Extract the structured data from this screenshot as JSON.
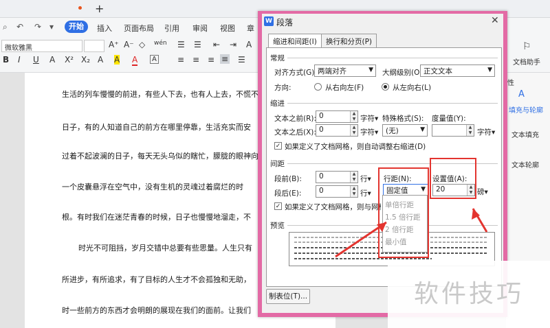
{
  "tabbar": {
    "new_tab_label": "+"
  },
  "menu": {
    "start": "开始",
    "items": [
      "插入",
      "页面布局",
      "引用",
      "审阅",
      "视图",
      "章"
    ]
  },
  "ribbon": {
    "font_name": "微软雅黑",
    "row1_glyphs": [
      "A⁺",
      "A⁻",
      "◇",
      "wén",
      "☰",
      "☰",
      "⇤",
      "⇥",
      "A"
    ],
    "row2_glyphs": [
      "B",
      "I",
      "U",
      "A",
      "X²",
      "X₂",
      "A",
      "A",
      "A",
      "A",
      "≡",
      "≡",
      "≡",
      "≡",
      "☰"
    ]
  },
  "side": {
    "doc_helper": "文档助手",
    "attr": "性",
    "fill_outline": "填充与轮廓",
    "text_fill": "文本填充",
    "text_outline": "文本轮廓"
  },
  "doc_lines": [
    "生活的列车慢慢的前进，有些人下去，也有人上去，不慌不",
    "日子，有的人知道自己的前方在哪里停靠，生活充实而安",
    "过着不起波澜的日子，每天无头乌似的瞎忙，朦胧的眼神向",
    "一个皮囊悬浮在空气中，没有生机的灵魂过着腐烂的时",
    "根。有时我们在迷茫青春的时候，日子也慢慢地溜走，不",
    "时光不可阻挡，岁月交错中总要有些思量。人生只有",
    "所进步，有所追求，有了目标的人生才不会孤独和无助，",
    "时一些前方的东西才会明朗的展现在我们的面前。让我们"
  ],
  "dialog": {
    "title": "段落",
    "logo": "W",
    "close": "✕",
    "tabs": [
      "缩进和间距(I)",
      "换行和分页(P)"
    ],
    "general": {
      "section": "常规",
      "align_label": "对齐方式(G):",
      "align_value": "两端对齐",
      "outline_label": "大纲级别(O):",
      "outline_value": "正文文本",
      "direction_label": "方向:",
      "rtl": "从右向左(F)",
      "ltr": "从左向右(L)"
    },
    "indent": {
      "section": "缩进",
      "before_label": "文本之前(R):",
      "before_value": "0",
      "before_unit": "字符▾",
      "after_label": "文本之后(X):",
      "after_value": "0",
      "after_unit": "字符▾",
      "special_label": "特殊格式(S):",
      "special_value": "(无)",
      "measure_label": "度量值(Y):",
      "measure_unit": "字符▾",
      "grid_check": "如果定义了文档网格，则自动调整右缩进(D)"
    },
    "spacing": {
      "section": "间距",
      "before_label": "段前(B):",
      "before_value": "0",
      "before_unit": "行▾",
      "after_label": "段后(E):",
      "after_value": "0",
      "after_unit": "行▾",
      "line_label": "行距(N):",
      "line_value": "固定值",
      "set_label": "设置值(A):",
      "set_value": "20",
      "set_unit": "磅▾",
      "grid_check": "如果定义了文档网格，则与网格对"
    },
    "line_options": [
      "单倍行距",
      "1.5 倍行距",
      "2 倍行距",
      "最小值"
    ],
    "preview_label": "预览",
    "tabstop_button": "制表位(T)..."
  },
  "watermark": "软件技巧"
}
